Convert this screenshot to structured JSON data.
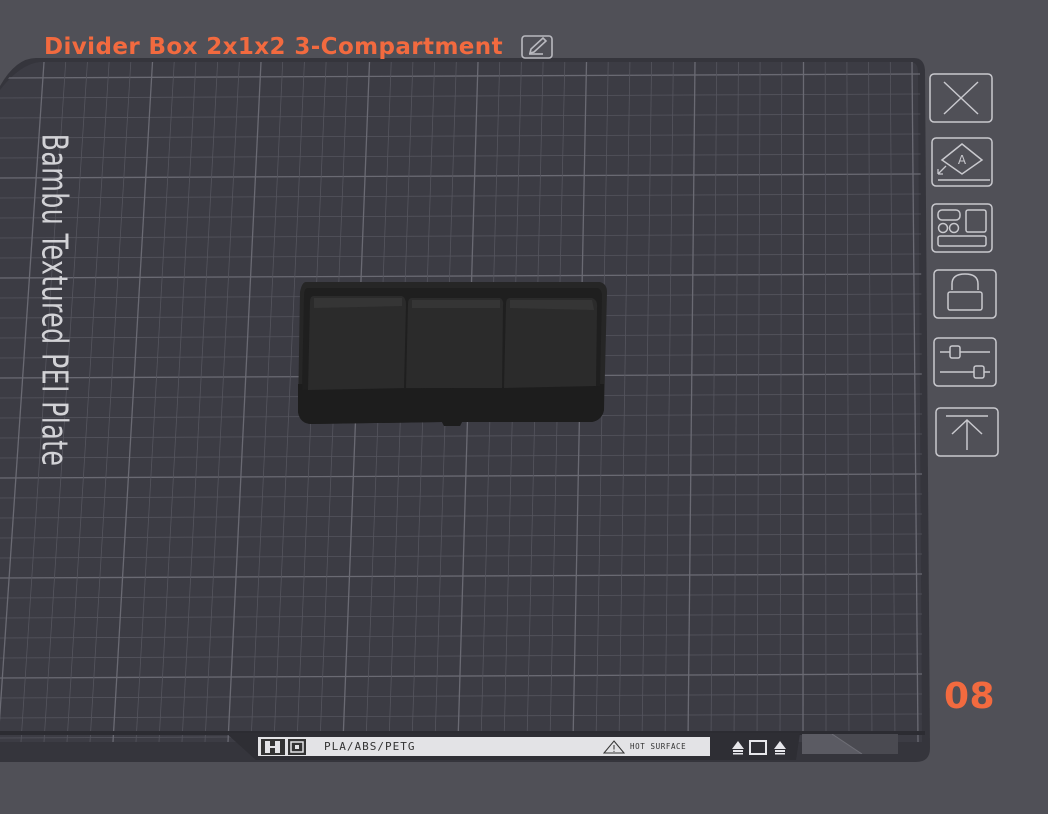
{
  "plate": {
    "title": "Divider Box 2x1x2 3-Compartment",
    "bed_label": "Bambu Textured PEI Plate",
    "index": "08"
  },
  "label_strip": {
    "material": "PLA/ABS/PETG",
    "hot_line1": "HOT",
    "hot_line2": "SURFACE"
  },
  "toolbar": [
    {
      "name": "remove-plate-button",
      "icon": "close-icon"
    },
    {
      "name": "auto-orient-button",
      "icon": "orient-icon"
    },
    {
      "name": "arrange-button",
      "icon": "arrange-icon"
    },
    {
      "name": "lock-plate-button",
      "icon": "lock-icon"
    },
    {
      "name": "plate-settings-button",
      "icon": "sliders-icon"
    },
    {
      "name": "move-to-top-button",
      "icon": "move-top-icon"
    }
  ],
  "colors": {
    "accent": "#f26a3f",
    "background": "#505057",
    "plate": "#3a3a42",
    "model": "#1e1e1e"
  }
}
